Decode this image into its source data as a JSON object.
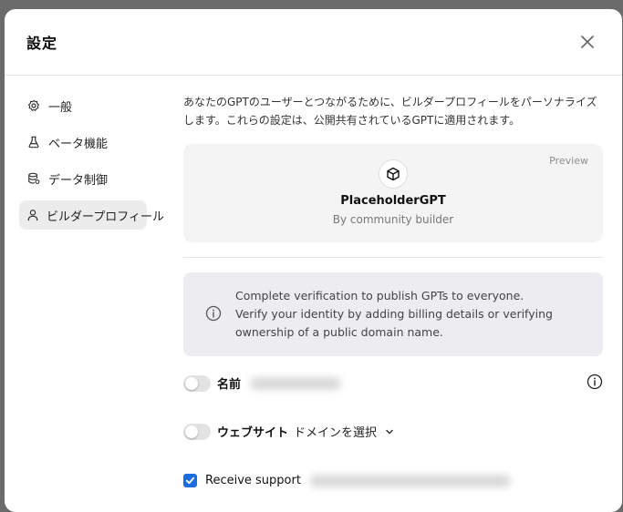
{
  "modal": {
    "title": "設定",
    "close_icon": "close-icon"
  },
  "sidebar": {
    "items": [
      {
        "label": "一般",
        "icon": "gear-icon",
        "active": false
      },
      {
        "label": "ベータ機能",
        "icon": "flask-icon",
        "active": false
      },
      {
        "label": "データ制御",
        "icon": "database-icon",
        "active": false
      },
      {
        "label": "ビルダープロフィール",
        "icon": "user-icon",
        "active": true
      }
    ]
  },
  "builder_profile": {
    "description": "あなたのGPTのユーザーとつながるために、ビルダープロフィールをパーソナライズします。これらの設定は、公開共有されているGPTに適用されます。",
    "preview": {
      "label": "Preview",
      "gpt_name": "PlaceholderGPT",
      "by_line": "By community builder",
      "avatar_icon": "cube-icon"
    },
    "notice": {
      "line1": "Complete verification to publish GPTs to everyone.",
      "line2": "Verify your identity by adding billing details or verifying ownership of a public domain name."
    },
    "name_row": {
      "label": "名前",
      "enabled": false
    },
    "website_row": {
      "label": "ウェブサイト",
      "select_value": "ドメインを選択",
      "enabled": false
    },
    "support_row": {
      "label": "Receive support",
      "checked": true
    }
  },
  "colors": {
    "accent": "#1e6ddc",
    "notice_bg": "#ececf1",
    "active_nav_bg": "#ececec"
  }
}
